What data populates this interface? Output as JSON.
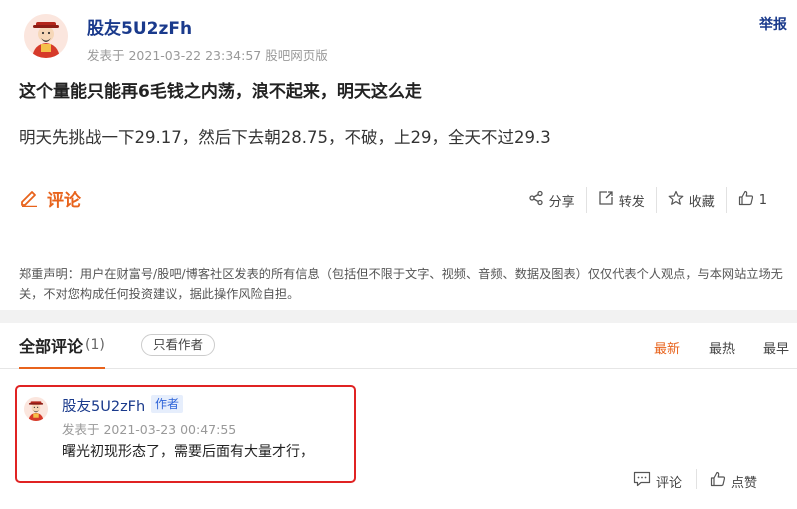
{
  "post": {
    "username": "股友5U2zFh",
    "meta": "发表于 2021-03-22 23:34:57 股吧网页版",
    "report_label": "举报",
    "title": "这个量能只能再6毛钱之内荡，浪不起来，明天这么走",
    "body": "明天先挑战一下29.17，然后下去朝28.75，不破，上29，全天不过29.3"
  },
  "actions": {
    "comment_label": "评论",
    "share_label": "分享",
    "repost_label": "转发",
    "favorite_label": "收藏",
    "like_count": "1"
  },
  "disclaimer": "郑重声明：用户在财富号/股吧/博客社区发表的所有信息（包括但不限于文字、视频、音频、数据及图表）仅仅代表个人观点，与本网站立场无关，不对您构成任何投资建议，据此操作风险自担。",
  "comments_section": {
    "tab_title": "全部评论",
    "tab_count": "(1)",
    "author_only_label": "只看作者",
    "sort_newest": "最新",
    "sort_hottest": "最热",
    "sort_earliest": "最早"
  },
  "comment": {
    "username": "股友5U2zFh",
    "author_tag": "作者",
    "meta": "发表于 2021-03-23 00:47:55",
    "text": "曙光初现形态了，需要后面有大量才行，",
    "reply_label": "评论",
    "like_label": "点赞"
  },
  "colors": {
    "accent": "#e8631c",
    "username": "#1a3a8c",
    "highlight_border": "#e02323",
    "author_tag_bg": "#e6eefc"
  },
  "icons": [
    "avatar-mascot",
    "pencil-icon",
    "share-icon",
    "repost-icon",
    "star-icon",
    "thumbs-up-icon",
    "comment-bubble-icon"
  ]
}
